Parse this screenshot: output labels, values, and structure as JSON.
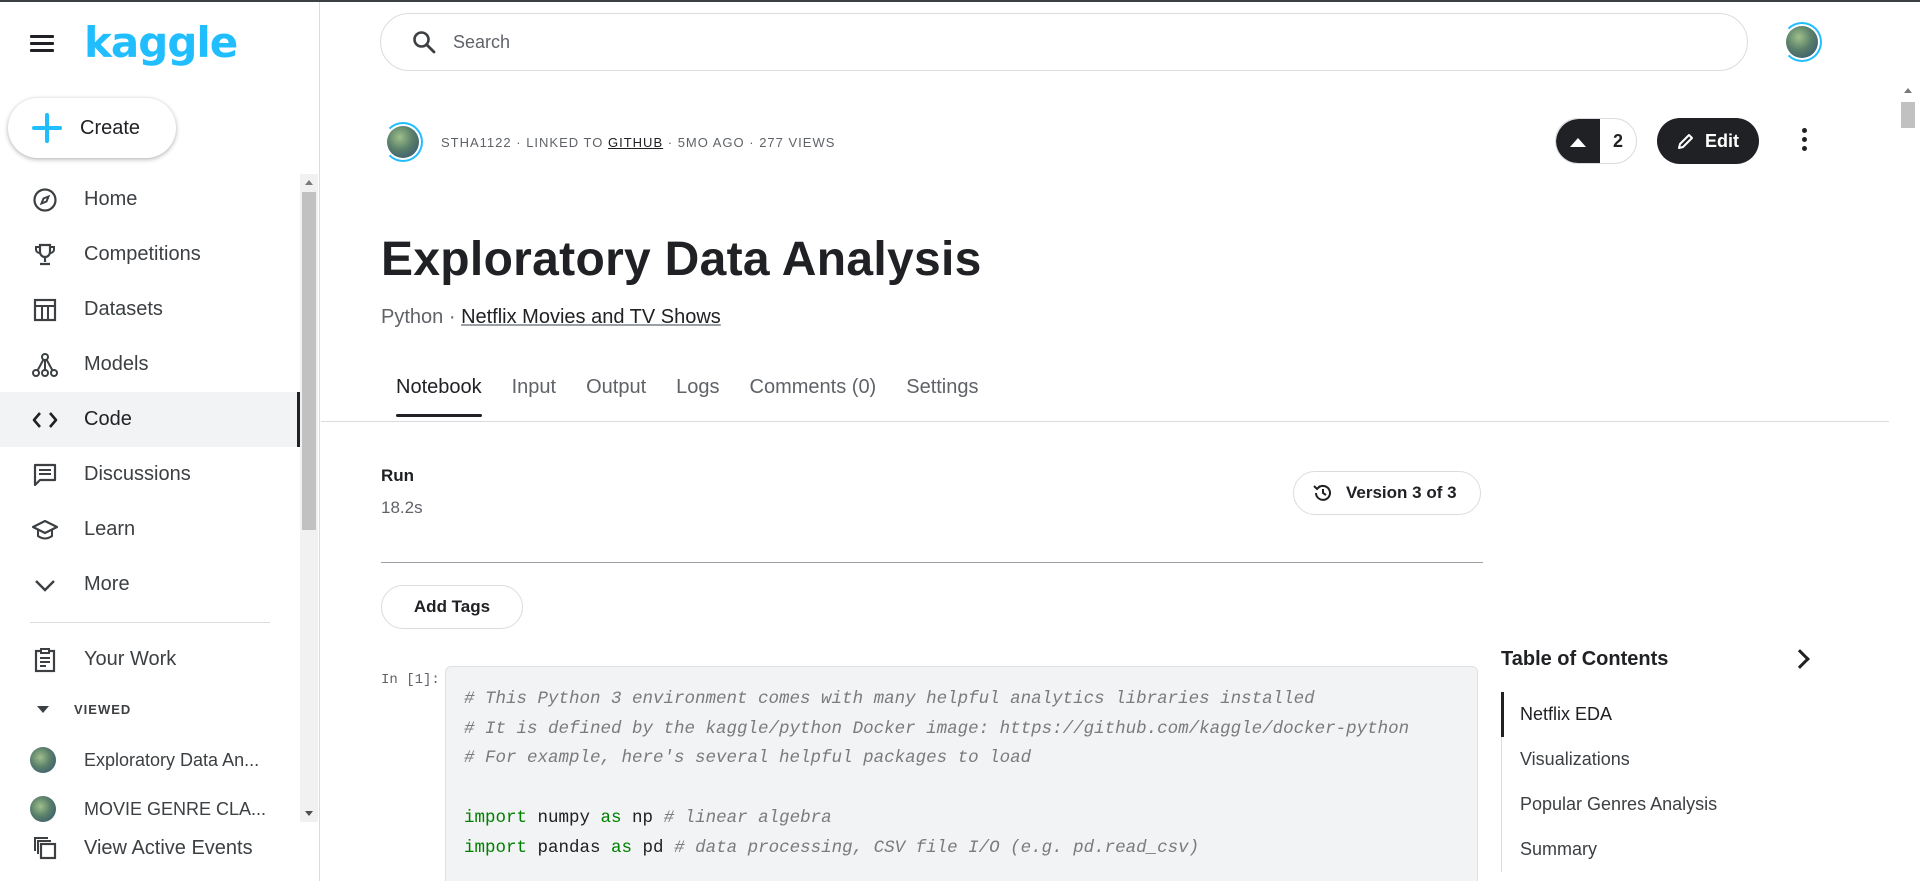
{
  "app": {
    "logo": "kaggle"
  },
  "sidebar": {
    "create_label": "Create",
    "items": [
      {
        "label": "Home",
        "icon": "compass-icon"
      },
      {
        "label": "Competitions",
        "icon": "trophy-icon"
      },
      {
        "label": "Datasets",
        "icon": "table-icon"
      },
      {
        "label": "Models",
        "icon": "models-icon"
      },
      {
        "label": "Code",
        "icon": "code-icon",
        "active": true
      },
      {
        "label": "Discussions",
        "icon": "comments-icon"
      },
      {
        "label": "Learn",
        "icon": "school-icon"
      },
      {
        "label": "More",
        "icon": "chevron-down-icon"
      }
    ],
    "your_work": "Your Work",
    "viewed_header": "VIEWED",
    "viewed_items": [
      "Exploratory Data An...",
      "MOVIE GENRE CLA..."
    ],
    "active_events": "View Active Events"
  },
  "search": {
    "placeholder": "Search"
  },
  "notebook": {
    "author": "STHA1122",
    "linked_prefix": "· LINKED TO",
    "linked_to": "GITHUB",
    "meta_suffix": "· 5MO AGO · 277 VIEWS",
    "vote_count": "2",
    "edit_label": "Edit",
    "title": "Exploratory Data Analysis",
    "language": "Python",
    "separator": "·",
    "dataset": "Netflix Movies and TV Shows",
    "tabs": [
      "Notebook",
      "Input",
      "Output",
      "Logs",
      "Comments (0)",
      "Settings"
    ],
    "run_label": "Run",
    "run_time": "18.2s",
    "version_label": "Version 3 of 3",
    "add_tags_label": "Add Tags",
    "cell_prompt": "In [1]:",
    "code_lines": [
      {
        "parts": [
          {
            "t": "cm",
            "v": "# This Python 3 environment comes with many helpful analytics libraries installed"
          }
        ]
      },
      {
        "parts": [
          {
            "t": "cm",
            "v": "# It is defined by the kaggle/python Docker image: https://github.com/kaggle/docker-python"
          }
        ]
      },
      {
        "parts": [
          {
            "t": "cm",
            "v": "# For example, here's several helpful packages to load"
          }
        ]
      },
      {
        "parts": [
          {
            "t": "tx",
            "v": " "
          }
        ]
      },
      {
        "parts": [
          {
            "t": "kw",
            "v": "import"
          },
          {
            "t": "tx",
            "v": " numpy "
          },
          {
            "t": "kw",
            "v": "as"
          },
          {
            "t": "tx",
            "v": " np "
          },
          {
            "t": "cm",
            "v": "# linear algebra"
          }
        ]
      },
      {
        "parts": [
          {
            "t": "kw",
            "v": "import"
          },
          {
            "t": "tx",
            "v": " pandas "
          },
          {
            "t": "kw",
            "v": "as"
          },
          {
            "t": "tx",
            "v": " pd "
          },
          {
            "t": "cm",
            "v": "# data processing, CSV file I/O (e.g. pd.read_csv)"
          }
        ]
      }
    ]
  },
  "toc": {
    "title": "Table of Contents",
    "items": [
      "Netflix EDA",
      "Visualizations",
      "Popular Genres Analysis",
      "Summary"
    ]
  },
  "colors": {
    "brand": "#20beff",
    "dark": "#202124",
    "keyword": "#008000",
    "comment": "#7b7b7b"
  }
}
